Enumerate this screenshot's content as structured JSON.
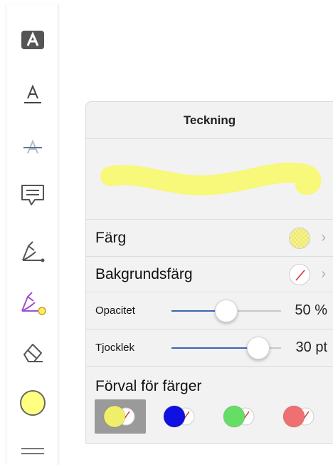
{
  "toolbar": {
    "tools": [
      {
        "name": "text-box-tool",
        "icon": "filled-letter-a-icon"
      },
      {
        "name": "underline-tool",
        "icon": "underlined-letter-a-icon"
      },
      {
        "name": "strikethrough-tool",
        "icon": "strikethrough-letter-a-icon"
      },
      {
        "name": "note-tool",
        "icon": "speech-bubble-icon"
      },
      {
        "name": "pen-tool",
        "icon": "pen-icon"
      },
      {
        "name": "highlighter-tool",
        "icon": "highlighter-pen-icon"
      },
      {
        "name": "eraser-tool",
        "icon": "eraser-icon"
      },
      {
        "name": "current-color",
        "icon": "color-circle-icon"
      },
      {
        "name": "more-tool",
        "icon": "handle-lines-icon"
      }
    ],
    "current_color": "#ffff80",
    "highlighter_color": "#a050d0"
  },
  "panel": {
    "title": "Teckning",
    "stroke_preview_color": "#f8f87a",
    "color_label": "Färg",
    "color_value": "#f5f060",
    "background_label": "Bakgrundsfärg",
    "background_value": "none",
    "opacity_label": "Opacitet",
    "opacity_value": "50 %",
    "opacity_fraction": 0.5,
    "thickness_label": "Tjocklek",
    "thickness_value": "30 pt",
    "thickness_fraction": 0.79,
    "slider_color": "#3a64b8",
    "presets_title": "Förval för färger",
    "presets": [
      {
        "color": "#f0ef6a",
        "selected": true
      },
      {
        "color": "#1010e0",
        "selected": false
      },
      {
        "color": "#66dd66",
        "selected": false
      },
      {
        "color": "#ee7070",
        "selected": false
      }
    ]
  }
}
